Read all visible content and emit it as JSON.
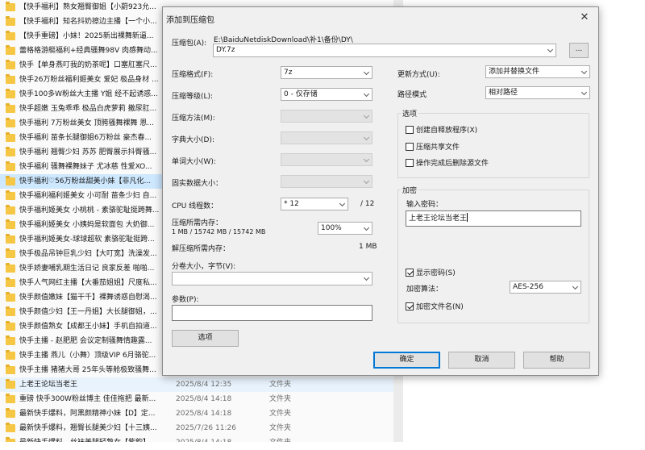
{
  "file_list": {
    "rows": [
      {
        "name": "【快手福利】熟女翘臀御姐【小蔚923允...",
        "date": "",
        "type": "",
        "state": ""
      },
      {
        "name": "【快手福利】知名抖奶擦边主播【一个小...",
        "date": "",
        "type": "",
        "state": ""
      },
      {
        "name": "【快手重磅】小妹！2025新出裸舞新逼...",
        "date": "",
        "type": "",
        "state": ""
      },
      {
        "name": "蕾格格游艇福利+经典骚舞98V 肉感舞动...",
        "date": "",
        "type": "",
        "state": ""
      },
      {
        "name": "快手【单身燕叮我的奶茶呢】口塞肛塞尺...",
        "date": "",
        "type": "",
        "state": ""
      },
      {
        "name": "快手26万粉丝福利姬美女 爱妃 极品身材 ...",
        "date": "",
        "type": "",
        "state": ""
      },
      {
        "name": "快手100多W粉丝大主播 Y姐 经不起诱惑...",
        "date": "",
        "type": "",
        "state": ""
      },
      {
        "name": "快手超嫩 玉兔乖乖 极品白虎萝莉 撒尿肛...",
        "date": "",
        "type": "",
        "state": ""
      },
      {
        "name": "快手福利 7万粉丝美女 顶胯骚舞裸舞 恩...",
        "date": "",
        "type": "",
        "state": ""
      },
      {
        "name": "快手福利 苗条长腿御姐6万粉丝 豪杰春...",
        "date": "",
        "type": "",
        "state": ""
      },
      {
        "name": "快手福利 翘臀少妇 苏苏 肥臀展示抖臀骚...",
        "date": "",
        "type": "",
        "state": ""
      },
      {
        "name": "快手福利 骚舞裸舞妹子 尤冰慈 性爱XO...",
        "date": "",
        "type": "",
        "state": ""
      },
      {
        "name": "快手福利♡56万粉丝甜美小妹【非凡化...",
        "date": "",
        "type": "",
        "state": "sel"
      },
      {
        "name": "快手福利福利姬美女 小可耐 苗条少妇 自...",
        "date": "",
        "type": "",
        "state": ""
      },
      {
        "name": "快手福利姬美女 小桃桃 - 素骆驼耻挺跨舞...",
        "date": "",
        "type": "",
        "state": ""
      },
      {
        "name": "快手福利姬美女 小姨妈是软面包 大奶御...",
        "date": "",
        "type": "",
        "state": ""
      },
      {
        "name": "快手福利姬美女-球球超软 素骆驼耻挺跨...",
        "date": "",
        "type": "",
        "state": ""
      },
      {
        "name": "快手极品吊钟巨乳少妇【大叮宽】洗澡发...",
        "date": "",
        "type": "",
        "state": ""
      },
      {
        "name": "快手娇妻哺乳期生活日记 良家反差 啪啪...",
        "date": "",
        "type": "",
        "state": ""
      },
      {
        "name": "快手人气网红主播【大番茄姐姐】尺度私...",
        "date": "",
        "type": "",
        "state": ""
      },
      {
        "name": "快手颜值嫩妹【猫干千】裸舞诱惑自慰渴...",
        "date": "",
        "type": "",
        "state": ""
      },
      {
        "name": "快手颜值少妇【王一丹姐】大长腿御姐，...",
        "date": "",
        "type": "",
        "state": ""
      },
      {
        "name": "快手颜值熟女【成都王小妹】手机自拍道...",
        "date": "",
        "type": "",
        "state": ""
      },
      {
        "name": "快手主播 - 赵肥肥 会议定制骚舞情趣露...",
        "date": "",
        "type": "",
        "state": ""
      },
      {
        "name": "快手主播 燕儿（小舞）顶级VIP 6月骆驼...",
        "date": "",
        "type": "",
        "state": ""
      },
      {
        "name": "快手主播 猪猪大哥 25年头等舱极致骚舞...",
        "date": "",
        "type": "",
        "state": ""
      },
      {
        "name": "上老王论坛当老王",
        "date": "2025/8/4 12:35",
        "type": "文件夹",
        "state": "hov"
      },
      {
        "name": "重磅 快手300W粉丝博主 佳佳拖把 最新...",
        "date": "2025/8/4 14:18",
        "type": "文件夹",
        "state": ""
      },
      {
        "name": "最新快手爆料，阿黑颜精神小妹【D】定...",
        "date": "2025/8/4 14:18",
        "type": "文件夹",
        "state": ""
      },
      {
        "name": "最新快手爆料，翘臀长腿美少妇【十三姨...",
        "date": "2025/7/26 11:26",
        "type": "文件夹",
        "state": ""
      },
      {
        "name": "最新快手爆料，丝袜美腿轻熟女【紫韵】...",
        "date": "2025/8/4 14:18",
        "type": "文件夹",
        "state": ""
      }
    ]
  },
  "dialog": {
    "title": "添加到压缩包",
    "close_glyph": "✕",
    "archive_label": "压缩包(A):",
    "archive_path": "E:\\BaiduNetdiskDownload\\补1\\备份\\DY\\",
    "archive_name": "DY.7z",
    "browse_label": "...",
    "format_label": "压缩格式(F):",
    "format_value": "7z",
    "level_label": "压缩等级(L):",
    "level_value": "0 - 仅存储",
    "method_label": "压缩方法(M):",
    "dict_label": "字典大小(D):",
    "word_label": "单词大小(W):",
    "solid_label": "固实数据大小：",
    "threads_label": "CPU 线程数：",
    "threads_value": "* 12",
    "threads_max": "/ 12",
    "mem_comp_label": "压缩所需内存：",
    "mem_comp_detail": "1 MB / 15742 MB / 15742 MB",
    "mem_percent": "100%",
    "mem_decomp_label": "解压缩所需内存：",
    "mem_decomp_value": "1 MB",
    "split_label": "分卷大小，字节(V):",
    "split_value": "",
    "params_label": "参数(P):",
    "params_value": "",
    "options_button": "选项",
    "update_label": "更新方式(U):",
    "update_value": "添加并替换文件",
    "path_label": "路径模式",
    "path_value": "相对路径",
    "options_group": "选项",
    "opt_sfx": "创建自释放程序(X)",
    "opt_shared": "压缩共享文件",
    "opt_delete": "操作完成后删除源文件",
    "encrypt_group": "加密",
    "password_label": "输入密码：",
    "password_value": "上老王论坛当老王",
    "show_password": "显示密码(S)",
    "enc_method_label": "加密算法：",
    "enc_method_value": "AES-256",
    "encrypt_names": "加密文件名(N)",
    "ok": "确定",
    "cancel": "取消",
    "help": "帮助"
  },
  "colors": {
    "dialog_bg": "#f0f0f0",
    "selected_row": "#cde8ff",
    "folder": "#f6c744",
    "default_button_border": "#0078d7"
  }
}
